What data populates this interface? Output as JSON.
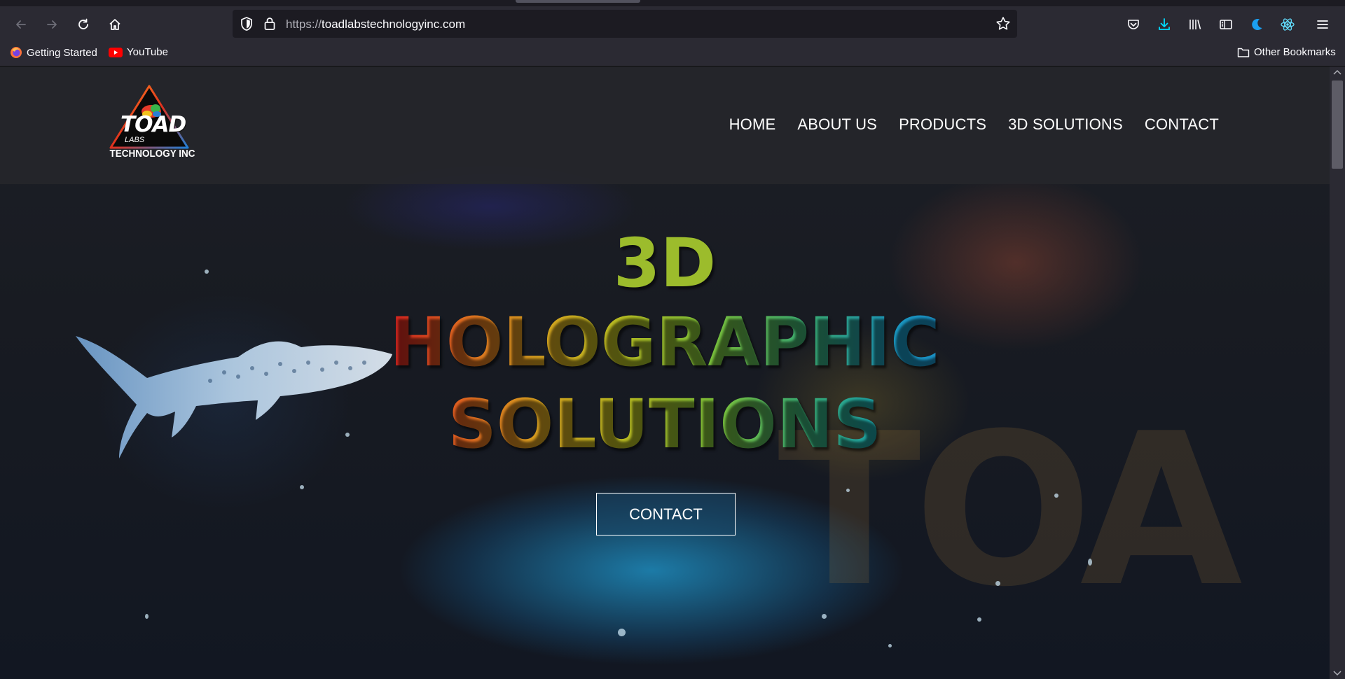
{
  "browser": {
    "url": "https://toadlabstechnologyinc.com",
    "url_prefix": "https://",
    "url_host": "toadlabstechnologyinc.com",
    "bookmarks": [
      {
        "label": "Getting Started",
        "icon": "firefox-icon"
      },
      {
        "label": "YouTube",
        "icon": "youtube-icon"
      }
    ],
    "other_bookmarks": "Other Bookmarks",
    "accent_color": "#00ddff"
  },
  "site": {
    "logo": {
      "word": "TOAD",
      "labs": "LABS",
      "subtitle": "TECHNOLOGY INC"
    },
    "nav": [
      "HOME",
      "ABOUT US",
      "PRODUCTS",
      "3D SOLUTIONS",
      "CONTACT"
    ],
    "hero": {
      "line1": "3D",
      "line2": "HOLOGRAPHIC",
      "line3": "SOLUTIONS",
      "cta": "CONTACT",
      "ghost_text": "TOA"
    }
  }
}
